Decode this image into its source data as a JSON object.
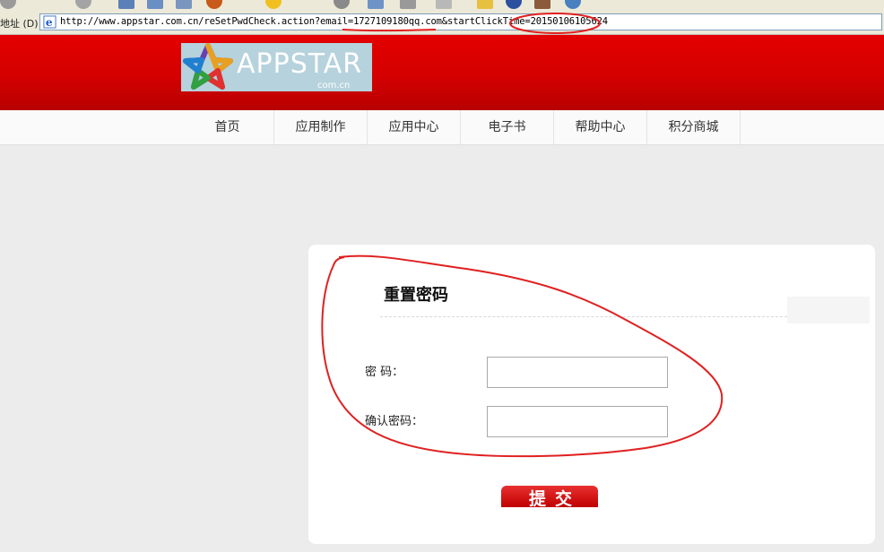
{
  "address_bar": {
    "label": "地址 (D)",
    "url": "http://www.appstar.com.cn/reSetPwdCheck.action?email=1727109180qq.com&startClickTime=20150106105624"
  },
  "header": {
    "logo_text": "APPSTAR",
    "logo_subtext": "com.cn",
    "background_color": "#d40000"
  },
  "nav": {
    "items": [
      {
        "label": "首页"
      },
      {
        "label": "应用制作"
      },
      {
        "label": "应用中心"
      },
      {
        "label": "电子书"
      },
      {
        "label": "帮助中心"
      },
      {
        "label": "积分商城"
      }
    ]
  },
  "reset_form": {
    "title": "重置密码",
    "password_label": "密  码：",
    "password_value": "",
    "confirm_label": "确认密码：",
    "confirm_value": "",
    "submit_label": "提交"
  },
  "colors": {
    "accent": "#d40000",
    "annotation": "#e02020"
  },
  "icons": [
    "ie-page-icon",
    "appstar-star-logo"
  ]
}
